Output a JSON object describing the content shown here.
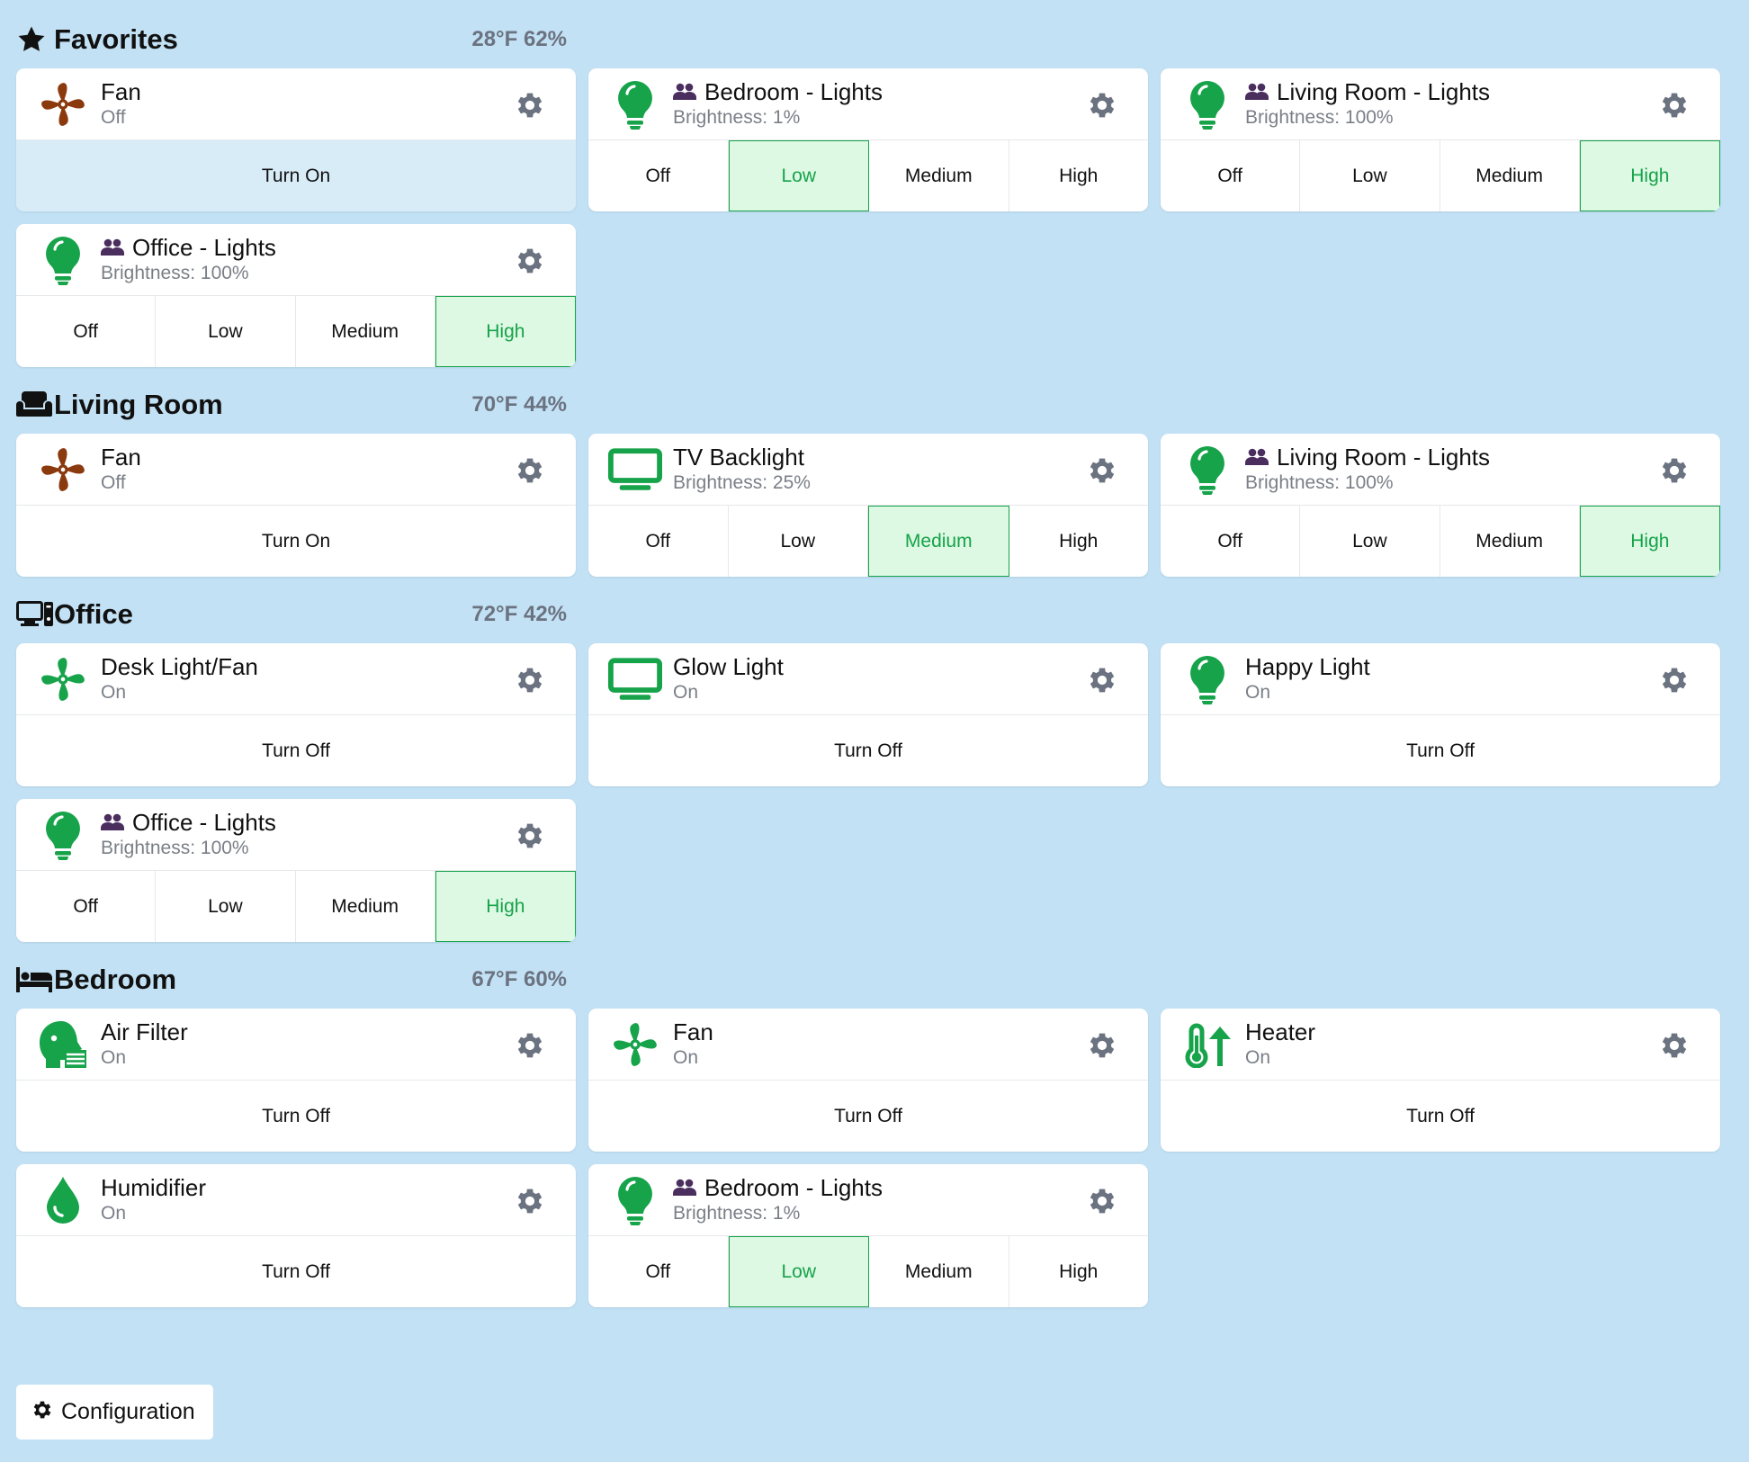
{
  "colors": {
    "background": "#c2e1f5",
    "active_green": "#16a34a",
    "active_bg": "#ddf8e3",
    "fan_off_brown": "#8b3a0e",
    "gear_gray": "#6b7280",
    "group_purple": "#4a2e5e"
  },
  "rooms": [
    {
      "name": "Favorites",
      "icon": "star-icon",
      "weather": "28°F 62%",
      "devices": [
        {
          "name": "Fan",
          "status": "Off",
          "icon": "fan-icon",
          "group": false,
          "control": "toggle",
          "button": "Turn On",
          "tint": true
        },
        {
          "name": "Bedroom - Lights",
          "status": "Brightness: 1%",
          "icon": "lightbulb-icon",
          "group": true,
          "control": "levels",
          "levels": [
            "Off",
            "Low",
            "Medium",
            "High"
          ],
          "active": "Low"
        },
        {
          "name": "Living Room - Lights",
          "status": "Brightness: 100%",
          "icon": "lightbulb-icon",
          "group": true,
          "control": "levels",
          "levels": [
            "Off",
            "Low",
            "Medium",
            "High"
          ],
          "active": "High"
        },
        {
          "name": "Office - Lights",
          "status": "Brightness: 100%",
          "icon": "lightbulb-icon",
          "group": true,
          "control": "levels",
          "levels": [
            "Off",
            "Low",
            "Medium",
            "High"
          ],
          "active": "High"
        }
      ]
    },
    {
      "name": "Living Room",
      "icon": "couch-icon",
      "weather": "70°F 44%",
      "devices": [
        {
          "name": "Fan",
          "status": "Off",
          "icon": "fan-icon",
          "group": false,
          "control": "toggle",
          "button": "Turn On"
        },
        {
          "name": "TV Backlight",
          "status": "Brightness: 25%",
          "icon": "tv-icon",
          "group": false,
          "control": "levels",
          "levels": [
            "Off",
            "Low",
            "Medium",
            "High"
          ],
          "active": "Medium"
        },
        {
          "name": "Living Room - Lights",
          "status": "Brightness: 100%",
          "icon": "lightbulb-icon",
          "group": true,
          "control": "levels",
          "levels": [
            "Off",
            "Low",
            "Medium",
            "High"
          ],
          "active": "High"
        }
      ]
    },
    {
      "name": "Office",
      "icon": "computer-icon",
      "weather": "72°F 42%",
      "devices": [
        {
          "name": "Desk Light/Fan",
          "status": "On",
          "icon": "fan-icon",
          "group": false,
          "control": "toggle",
          "button": "Turn Off",
          "on": true
        },
        {
          "name": "Glow Light",
          "status": "On",
          "icon": "tv-icon",
          "group": false,
          "control": "toggle",
          "button": "Turn Off"
        },
        {
          "name": "Happy Light",
          "status": "On",
          "icon": "lightbulb-icon",
          "group": false,
          "control": "toggle",
          "button": "Turn Off"
        },
        {
          "name": "Office - Lights",
          "status": "Brightness: 100%",
          "icon": "lightbulb-icon",
          "group": true,
          "control": "levels",
          "levels": [
            "Off",
            "Low",
            "Medium",
            "High"
          ],
          "active": "High"
        }
      ]
    },
    {
      "name": "Bedroom",
      "icon": "bed-icon",
      "weather": "67°F 60%",
      "devices": [
        {
          "name": "Air Filter",
          "status": "On",
          "icon": "air-filter-icon",
          "group": false,
          "control": "toggle",
          "button": "Turn Off"
        },
        {
          "name": "Fan",
          "status": "On",
          "icon": "fan-icon",
          "group": false,
          "control": "toggle",
          "button": "Turn Off",
          "on": true
        },
        {
          "name": "Heater",
          "status": "On",
          "icon": "heater-icon",
          "group": false,
          "control": "toggle",
          "button": "Turn Off"
        },
        {
          "name": "Humidifier",
          "status": "On",
          "icon": "water-drop-icon",
          "group": false,
          "control": "toggle",
          "button": "Turn Off"
        },
        {
          "name": "Bedroom - Lights",
          "status": "Brightness: 1%",
          "icon": "lightbulb-icon",
          "group": true,
          "control": "levels",
          "levels": [
            "Off",
            "Low",
            "Medium",
            "High"
          ],
          "active": "Low"
        }
      ]
    }
  ],
  "footer": {
    "config_label": "Configuration",
    "config_icon": "gear-icon"
  }
}
